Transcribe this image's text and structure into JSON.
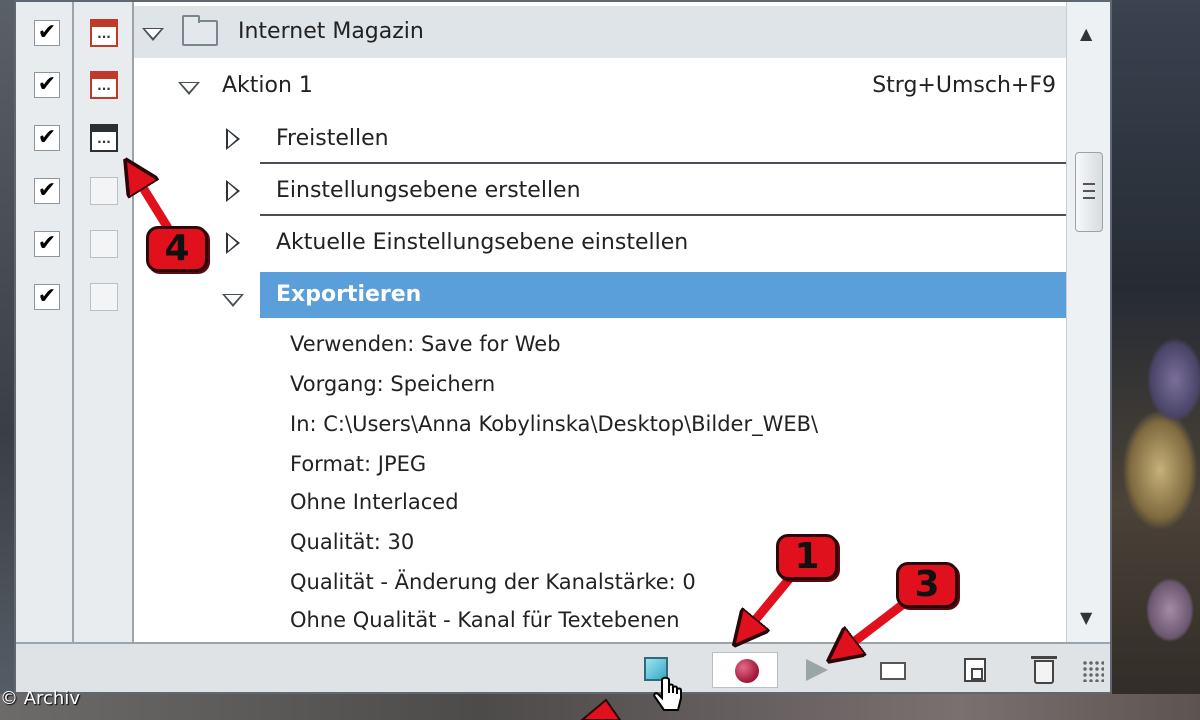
{
  "set": {
    "name": "Internet Magazin"
  },
  "action": {
    "name": "Aktion 1",
    "shortcut": "Strg+Umsch+F9"
  },
  "commands": [
    {
      "label": "Freistellen"
    },
    {
      "label": "Einstellungsebene erstellen"
    },
    {
      "label": "Aktuelle Einstellungsebene einstellen"
    }
  ],
  "selected_command": {
    "label": "Exportieren",
    "details": [
      "Verwenden: Save for Web",
      "Vorgang: Speichern",
      "In: C:\\Users\\Anna Kobylinska\\Desktop\\Bilder_WEB\\",
      "Format: JPEG",
      "Ohne Interlaced",
      "Qualität: 30",
      "Qualität - Änderung der Kanalstärke: 0",
      "Ohne Qualität - Kanal für Textebenen"
    ]
  },
  "dialog_icons": {
    "dots": "..."
  },
  "checkmarks": [
    "✔",
    "✔",
    "✔",
    "✔",
    "✔",
    "✔"
  ],
  "callouts": {
    "one": "1",
    "three": "3",
    "four": "4"
  },
  "copyright": "© Archiv",
  "colors": {
    "selection": "#5a9fda",
    "callout": "#e0101c",
    "record": "#a01535"
  }
}
